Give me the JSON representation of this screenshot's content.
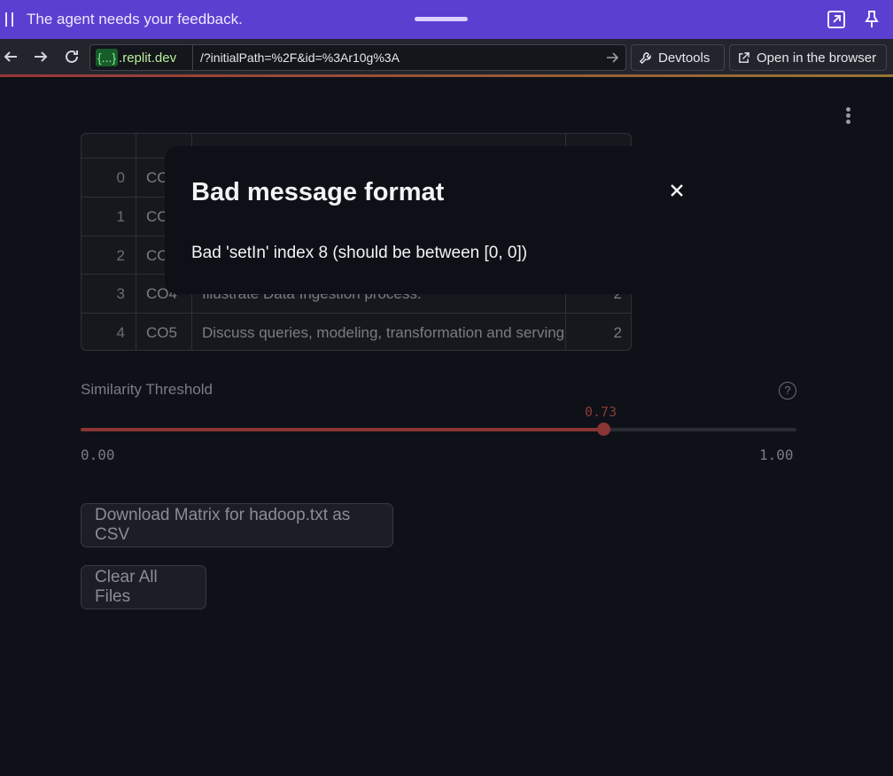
{
  "banner": {
    "message": "The agent needs your feedback.",
    "icons": [
      "pause-icon",
      "expand-icon",
      "pin-icon"
    ]
  },
  "browser": {
    "host_chip": "{...}",
    "host_domain": ".replit.dev",
    "path": "/?initialPath=%2F&id=%3Ar10g%3A",
    "devtools_label": "Devtools",
    "open_label": "Open in the browser"
  },
  "table": {
    "rows": [
      {
        "index": "0",
        "co": "CO1",
        "description": "",
        "level": ""
      },
      {
        "index": "1",
        "co": "CO2",
        "description": "",
        "level": ""
      },
      {
        "index": "2",
        "co": "CO3",
        "description": "",
        "level": ""
      },
      {
        "index": "3",
        "co": "CO4",
        "description": "Illustrate Data Ingestion process.",
        "level": "2"
      },
      {
        "index": "4",
        "co": "CO5",
        "description": "Discuss queries, modeling, transformation and serving.",
        "level": "2"
      }
    ]
  },
  "slider": {
    "label": "Similarity Threshold",
    "help": "?",
    "value": 0.73,
    "value_text": "0.73",
    "min_text": "0.00",
    "max_text": "1.00",
    "accent": "#8a3434"
  },
  "buttons": {
    "download": "Download Matrix for hadoop.txt as CSV",
    "clear": "Clear All Files"
  },
  "modal": {
    "title": "Bad message format",
    "message": "Bad 'setIn' index 8 (should be between [0, 0])"
  }
}
